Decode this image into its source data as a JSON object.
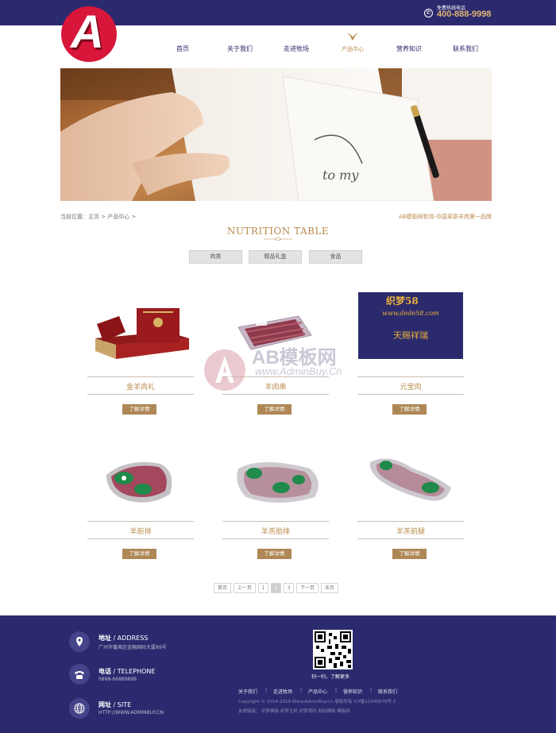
{
  "header": {
    "hotline_label": "免费热线电话",
    "hotline_number": "400-888-9998",
    "logo_letter": "A",
    "nav": [
      "首页",
      "关于我们",
      "走进牧场",
      "产品中心",
      "营养知识",
      "联系我们"
    ]
  },
  "breadcrumb": "当前位置：主页 > 产品中心 >",
  "slogan": "AB模板网牧场·中国草原羊肉第一品牌",
  "section_title": "NUTRITION TABLE",
  "tabs": [
    "肉类",
    "精品礼盒",
    "食品"
  ],
  "products": [
    {
      "name": "金羊肉礼",
      "button": "了解详情"
    },
    {
      "name": "羊肉串",
      "button": "了解详情"
    },
    {
      "name": "元宝肉",
      "button": "了解详情"
    },
    {
      "name": "羊前排",
      "button": "了解详情"
    },
    {
      "name": "羊羔肋排",
      "button": "了解详情"
    },
    {
      "name": "羊羔前腿",
      "button": "了解详情"
    }
  ],
  "promo_card": {
    "line1": "织梦58",
    "line2": "www.dede58.com",
    "line3": "天赐祥瑞"
  },
  "watermark": {
    "text": "AB模板网",
    "url": "www.AdminBuy.Cn"
  },
  "pagination": [
    "首页",
    "上一页",
    "1",
    "2",
    "3",
    "下一页",
    "末页"
  ],
  "pagination_current": 2,
  "footer": {
    "address_title": "地址",
    "address_en": "/ ADDRESS",
    "address_value": "广州市番禺区金融国际大厦89号",
    "phone_title": "电话",
    "phone_en": "/ TELEPHONE",
    "phone_value": "0898-66889899",
    "site_title": "网址",
    "site_en": "/ SITE",
    "site_value": "HTTP://WWW.ADMINBUY.CN",
    "qr_caption": "扫一扫，了解更多",
    "links": [
      "关于我们",
      "走进牧场",
      "产品中心",
      "营养知识",
      "联系我们"
    ],
    "copyright": "Copyright © 2014-2019 Www.AdminBuy.Cn 版权所有  ICP备12345678号-2",
    "friend_links": "友情链接：   织梦模板   织梦主机   织梦源码   网站模板   模板网"
  },
  "colors": {
    "primary": "#2c2a6e",
    "accent": "#b98a4b",
    "button": "#ae8856",
    "logo_red": "#d8163a"
  }
}
